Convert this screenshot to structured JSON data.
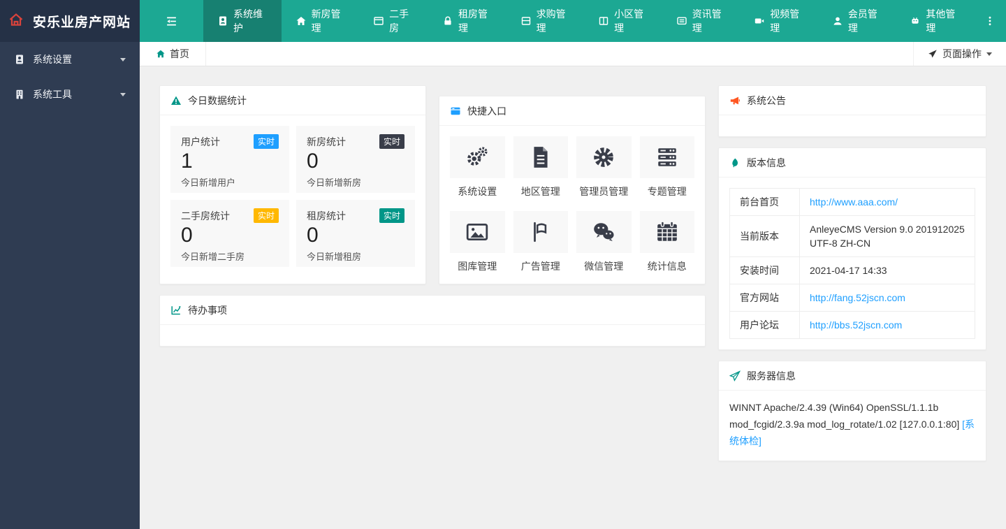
{
  "brand": {
    "site_title": "安乐业房产网站"
  },
  "topnav": {
    "items": [
      {
        "label": "系统维护",
        "active": true
      },
      {
        "label": "新房管理",
        "active": false
      },
      {
        "label": "二手房",
        "active": false
      },
      {
        "label": "租房管理",
        "active": false
      },
      {
        "label": "求购管理",
        "active": false
      },
      {
        "label": "小区管理",
        "active": false
      },
      {
        "label": "资讯管理",
        "active": false
      },
      {
        "label": "视频管理",
        "active": false
      },
      {
        "label": "会员管理",
        "active": false
      },
      {
        "label": "其他管理",
        "active": false
      }
    ]
  },
  "sidebar": {
    "items": [
      {
        "label": "系统设置"
      },
      {
        "label": "系统工具"
      }
    ]
  },
  "breadcrumb": {
    "home_tab": "首页",
    "page_actions": "页面操作"
  },
  "today_stats": {
    "title": "今日数据统计",
    "tiles": [
      {
        "name": "用户统计",
        "badge": "实时",
        "badge_color": "#1E9FFF",
        "value": "1",
        "desc": "今日新增用户"
      },
      {
        "name": "新房统计",
        "badge": "实时",
        "badge_color": "#393D49",
        "value": "0",
        "desc": "今日新增新房"
      },
      {
        "name": "二手房统计",
        "badge": "实时",
        "badge_color": "#FFB800",
        "value": "0",
        "desc": "今日新增二手房"
      },
      {
        "name": "租房统计",
        "badge": "实时",
        "badge_color": "#009688",
        "value": "0",
        "desc": "今日新增租房"
      }
    ]
  },
  "quick_entry": {
    "title": "快捷入口",
    "items": [
      {
        "label": "系统设置"
      },
      {
        "label": "地区管理"
      },
      {
        "label": "管理员管理"
      },
      {
        "label": "专题管理"
      },
      {
        "label": "图库管理"
      },
      {
        "label": "广告管理"
      },
      {
        "label": "微信管理"
      },
      {
        "label": "统计信息"
      }
    ]
  },
  "todo": {
    "title": "待办事项"
  },
  "announcement": {
    "title": "系统公告"
  },
  "version_info": {
    "title": "版本信息",
    "rows": [
      {
        "label": "前台首页",
        "value": "http://www.aaa.com/"
      },
      {
        "label": "当前版本",
        "value": "AnleyeCMS Version 9.0 201912025 UTF-8 ZH-CN"
      },
      {
        "label": "安装时间",
        "value": "2021-04-17 14:33"
      },
      {
        "label": "官方网站",
        "value": "http://fang.52jscn.com"
      },
      {
        "label": "用户论坛",
        "value": "http://bbs.52jscn.com"
      }
    ]
  },
  "server_info": {
    "title": "服务器信息",
    "text": "WINNT Apache/2.4.39 (Win64) OpenSSL/1.1.1b mod_fcgid/2.3.9a mod_log_rotate/1.02 [127.0.0.1:80] ",
    "link": "[系统体检]"
  },
  "colors": {
    "nav_teal": "#1CA893",
    "nav_active": "#178071",
    "logo_bg": "#253146",
    "sidebar_bg": "#2F3C52",
    "brand_red": "#D9433C",
    "link_blue": "#1E9FFF",
    "badge_blue": "#1E9FFF",
    "badge_dark": "#393D49",
    "badge_orange": "#FFB800",
    "badge_green": "#009688",
    "icon_teal": "#009688",
    "icon_red": "#FF5722"
  }
}
